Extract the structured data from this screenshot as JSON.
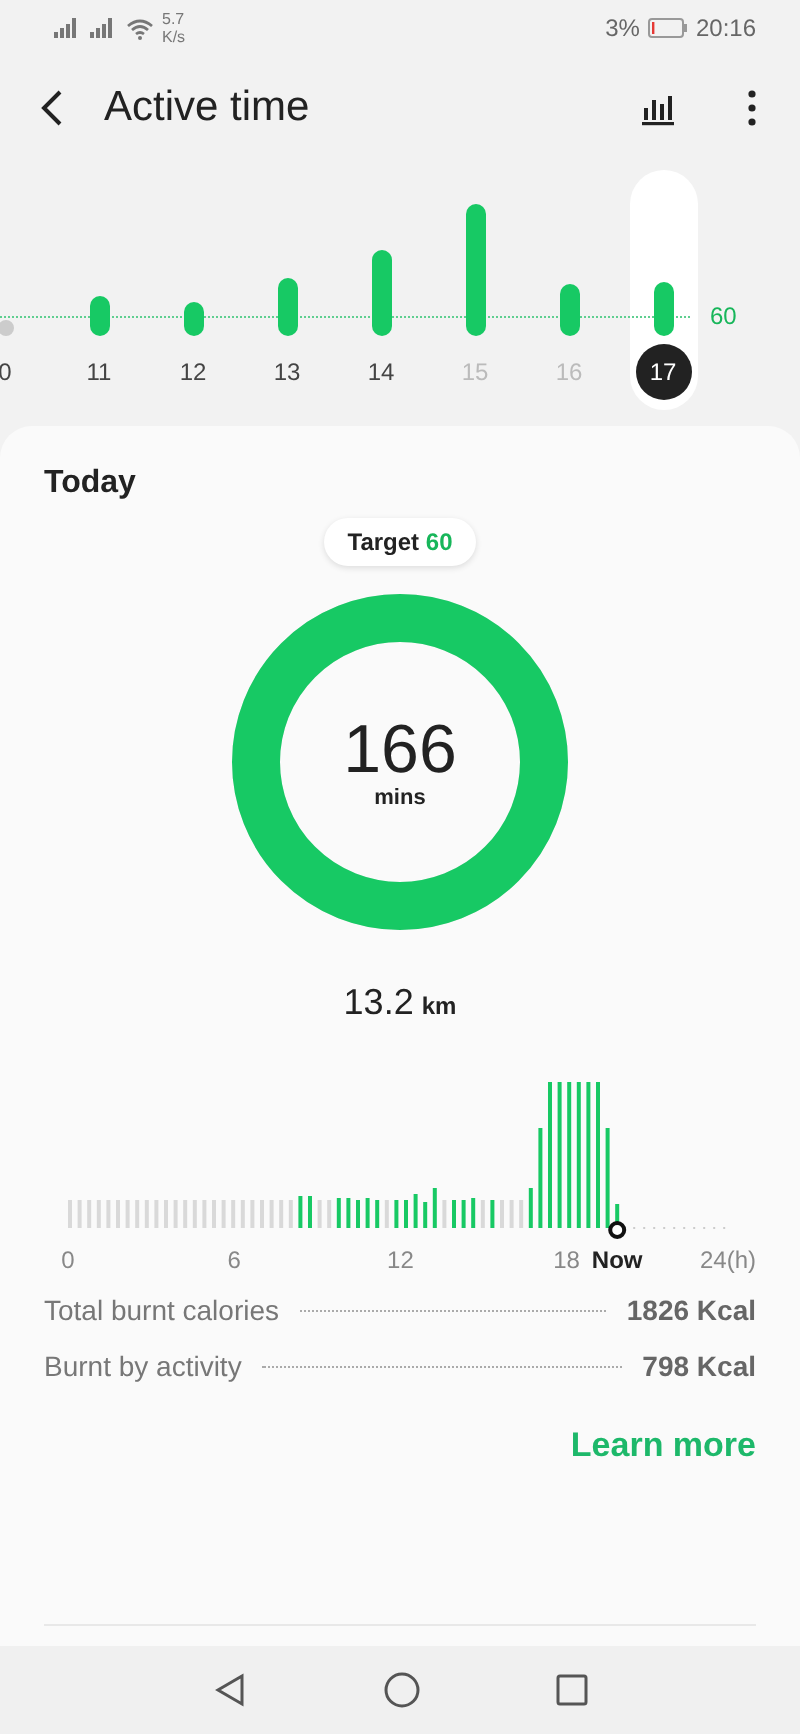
{
  "status_bar": {
    "network_speed": "5.7",
    "network_speed_unit": "K/s",
    "battery": "3%",
    "time": "20:16"
  },
  "header": {
    "title": "Active time"
  },
  "daily_chart": {
    "target_label": "60",
    "days": [
      {
        "label": "0",
        "selected": false,
        "dimmed": false
      },
      {
        "label": "11",
        "selected": false,
        "dimmed": false
      },
      {
        "label": "12",
        "selected": false,
        "dimmed": false
      },
      {
        "label": "13",
        "selected": false,
        "dimmed": false
      },
      {
        "label": "14",
        "selected": false,
        "dimmed": false
      },
      {
        "label": "15",
        "selected": false,
        "dimmed": true
      },
      {
        "label": "16",
        "selected": false,
        "dimmed": true
      },
      {
        "label": "17",
        "selected": true,
        "dimmed": false
      }
    ]
  },
  "today": {
    "title": "Today",
    "target_label": "Target",
    "target_value": "60",
    "ring": {
      "value": "166",
      "unit": "mins"
    }
  },
  "distance": {
    "value": "13.2",
    "unit": "km"
  },
  "hourly": {
    "axis_labels": [
      "0",
      "6",
      "12",
      "18",
      "24(h)"
    ],
    "now_label": "Now"
  },
  "stats": [
    {
      "label": "Total burnt calories",
      "value": "1826 Kcal"
    },
    {
      "label": "Burnt by activity",
      "value": "798 Kcal"
    }
  ],
  "learn_more": "Learn more"
}
